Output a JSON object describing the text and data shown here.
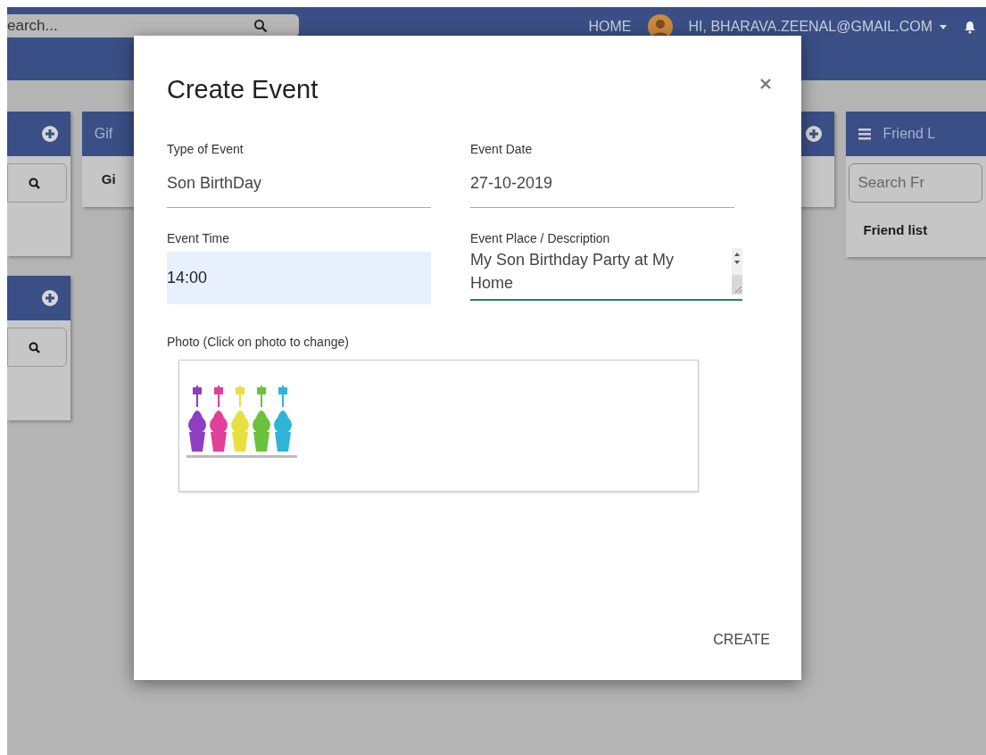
{
  "navbar": {
    "search": {
      "value": "earch..."
    },
    "links": [
      {
        "label": "HOME"
      }
    ],
    "user": {
      "label": "HI, BHARAVA.ZEENAL@GMAIL.COM"
    }
  },
  "columns": [
    [
      {
        "kind": "add_search"
      },
      {
        "kind": "add_search"
      }
    ],
    [
      {
        "kind": "titled",
        "title": "Gif",
        "item": "Gi"
      }
    ],
    [
      {
        "kind": "add"
      }
    ],
    [
      {
        "kind": "friend",
        "title": "Friend L",
        "search_placeholder": "Search Fr",
        "item": "Friend list"
      }
    ]
  ],
  "modal": {
    "title": "Create Event",
    "fields": [
      {
        "kind": "line",
        "label": "Type of Event",
        "value": "Son BirthDay"
      },
      {
        "kind": "line",
        "label": "Event Date",
        "value": "27-10-2019"
      },
      {
        "kind": "autofill",
        "label": "Event Time",
        "value": "14:00"
      },
      {
        "kind": "textarea",
        "label": "Event Place / Description",
        "value": "My Son Birthday Party at My Home"
      }
    ],
    "photo": {
      "label": "Photo (Click on photo to change)"
    },
    "button": "CREATE"
  }
}
